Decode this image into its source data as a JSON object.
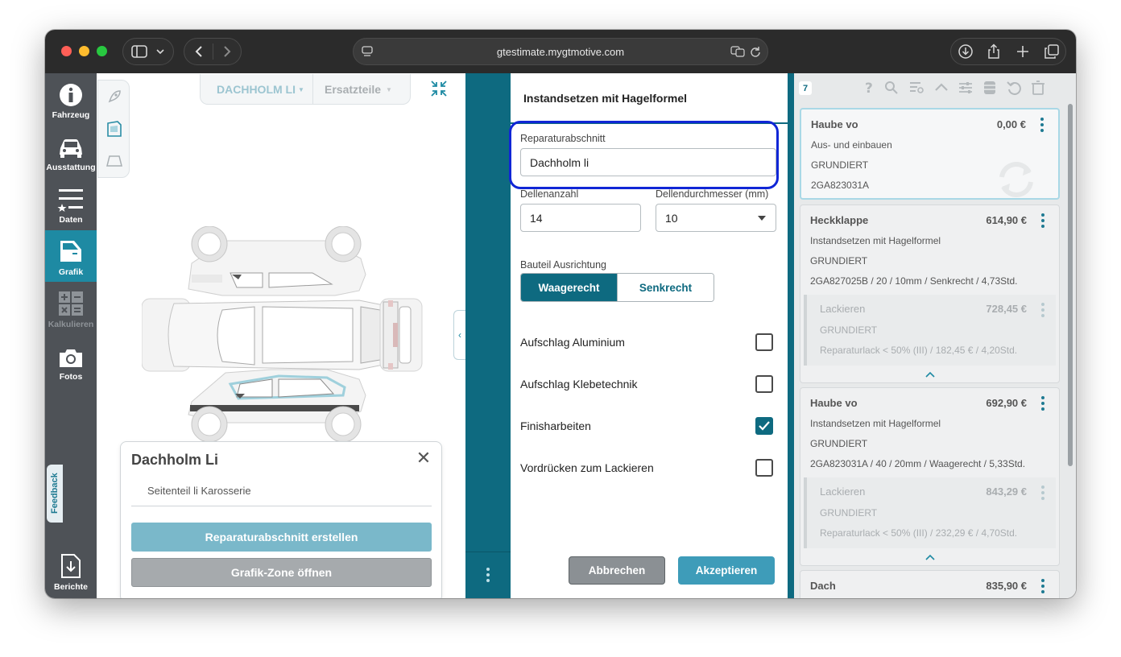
{
  "browser": {
    "url": "gtestimate.mygtmotive.com"
  },
  "sidebar": {
    "items": [
      {
        "label": "Fahrzeug",
        "icon": "info-icon"
      },
      {
        "label": "Ausstattung",
        "icon": "car-icon"
      },
      {
        "label": "Daten",
        "icon": "data-list-icon"
      },
      {
        "label": "Grafik",
        "icon": "car-door-icon",
        "active": true
      },
      {
        "label": "Kalkulieren",
        "icon": "calculator-icon",
        "disabled": true
      },
      {
        "label": "Fotos",
        "icon": "camera-icon"
      },
      {
        "label": "Berichte",
        "icon": "report-download-icon"
      }
    ],
    "feedback_label": "Feedback"
  },
  "graphic": {
    "tabs": [
      {
        "label": "DACHHOLM LI",
        "active": true
      },
      {
        "label": "Ersatzteile",
        "active": false
      }
    ],
    "popup": {
      "title": "Dachholm Li",
      "subtitle": "Seitenteil li Karosserie",
      "create_button": "Reparaturabschnitt erstellen",
      "open_zone_button": "Grafik-Zone öffnen"
    }
  },
  "form": {
    "title": "Instandsetzen mit Hagelformel",
    "section_label": "Reparaturabschnitt",
    "section_value": "Dachholm li",
    "dent_count_label": "Dellenanzahl",
    "dent_count_value": "14",
    "dent_diameter_label": "Dellendurchmesser (mm)",
    "dent_diameter_value": "10",
    "orientation_label": "Bauteil Ausrichtung",
    "orientation_options": [
      "Waagerecht",
      "Senkrecht"
    ],
    "orientation_selected": "Waagerecht",
    "checkboxes": [
      {
        "label": "Aufschlag Aluminium",
        "checked": false
      },
      {
        "label": "Aufschlag Klebetechnik",
        "checked": false
      },
      {
        "label": "Finisharbeiten",
        "checked": true
      },
      {
        "label": "Vordrücken zum Lackieren",
        "checked": false
      }
    ],
    "cancel_label": "Abbrechen",
    "accept_label": "Akzeptieren"
  },
  "list": {
    "count": "7",
    "cards": [
      {
        "title": "Haube vo",
        "price": "0,00 €",
        "lines": [
          "Aus- und einbauen",
          "GRUNDIERT",
          "2GA823031A"
        ]
      },
      {
        "title": "Heckklappe",
        "price": "614,90 €",
        "lines": [
          "Instandsetzen mit Hagelformel",
          "GRUNDIERT",
          "2GA827025B / 20 / 10mm / Senkrecht / 4,73Std."
        ],
        "sub": {
          "title": "Lackieren",
          "price": "728,45 €",
          "lines": [
            "GRUNDIERT",
            "Reparaturlack < 50% (III) / 182,45 € / 4,20Std."
          ]
        }
      },
      {
        "title": "Haube vo",
        "price": "692,90 €",
        "lines": [
          "Instandsetzen mit Hagelformel",
          "GRUNDIERT",
          "2GA823031A / 40 / 20mm / Waagerecht / 5,33Std."
        ],
        "sub": {
          "title": "Lackieren",
          "price": "843,29 €",
          "lines": [
            "GRUNDIERT",
            "Reparaturlack < 50% (III) / 232,29 € / 4,70Std."
          ]
        }
      },
      {
        "title": "Dach",
        "price": "835,90 €"
      }
    ]
  },
  "colors": {
    "teal": "#0e6a80",
    "accent": "#1e8aa3",
    "highlight": "#1026d6",
    "sidebar": "#4e5257"
  }
}
